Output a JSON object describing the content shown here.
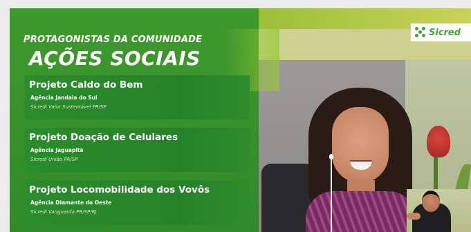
{
  "header": {
    "subtitle": "PROTAGONISTAS DA COMUNIDADE",
    "title": "AÇÕES SOCIAIS"
  },
  "logo": {
    "text": "Sicred",
    "color": "#3fa535"
  },
  "projects": [
    {
      "title": "Projeto Caldo do Bem",
      "agency": "Agência Jandaia do Sul",
      "cooperative": "Sicredi Valor Sustentável PR/SP"
    },
    {
      "title": "Projeto Doação de Celulares",
      "agency": "Agência Jaguapitã",
      "cooperative": "Sicredi União PR/SP"
    },
    {
      "title": "Projeto Locomobilidade dos Vovôs",
      "agency": "Agência Diamante do Oeste",
      "cooperative": "Sicredi Vanguarda PR/SP/RJ"
    }
  ],
  "colors": {
    "brand_green": "#3fa535",
    "panel_green": "#2b8c2c"
  }
}
